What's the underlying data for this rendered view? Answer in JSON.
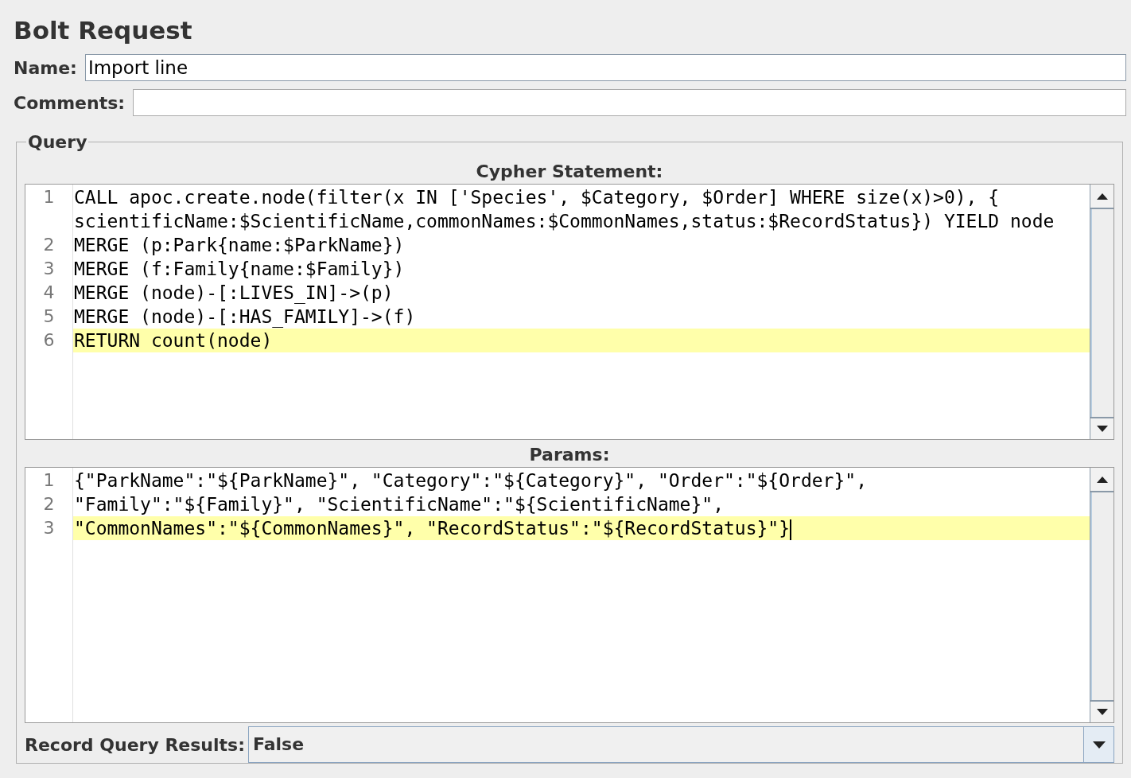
{
  "title": "Bolt Request",
  "name_field": {
    "label": "Name:",
    "value": "Import line"
  },
  "comments_field": {
    "label": "Comments:"
  },
  "query": {
    "legend": "Query",
    "editors": [
      {
        "label": "Cypher Statement:",
        "lines": [
          {
            "number": "1",
            "text": "CALL apoc.create.node(filter(x IN ['Species', $Category, $Order] WHERE size(x)>0), { scientificName:$ScientificName,commonNames:$CommonNames,status:$RecordStatus}) YIELD node",
            "highlighted": false,
            "caret": false
          },
          {
            "number": "2",
            "text": "MERGE (p:Park{name:$ParkName})",
            "highlighted": false,
            "caret": false
          },
          {
            "number": "3",
            "text": "MERGE (f:Family{name:$Family})",
            "highlighted": false,
            "caret": false
          },
          {
            "number": "4",
            "text": "MERGE (node)-[:LIVES_IN]->(p)",
            "highlighted": false,
            "caret": false
          },
          {
            "number": "5",
            "text": "MERGE (node)-[:HAS_FAMILY]->(f)",
            "highlighted": false,
            "caret": false
          },
          {
            "number": "6",
            "text": "RETURN count(node)",
            "highlighted": true,
            "caret": false
          }
        ]
      },
      {
        "label": "Params:",
        "lines": [
          {
            "number": "1",
            "text": "{\"ParkName\":\"${ParkName}\", \"Category\":\"${Category}\", \"Order\":\"${Order}\",",
            "highlighted": false,
            "caret": false
          },
          {
            "number": "2",
            "text": "\"Family\":\"${Family}\", \"ScientificName\":\"${ScientificName}\",",
            "highlighted": false,
            "caret": false
          },
          {
            "number": "3",
            "text": "\"CommonNames\":\"${CommonNames}\", \"RecordStatus\":\"${RecordStatus}\"}",
            "highlighted": true,
            "caret": true
          }
        ]
      }
    ],
    "record": {
      "label": "Record Query Results:",
      "value": "False"
    }
  }
}
